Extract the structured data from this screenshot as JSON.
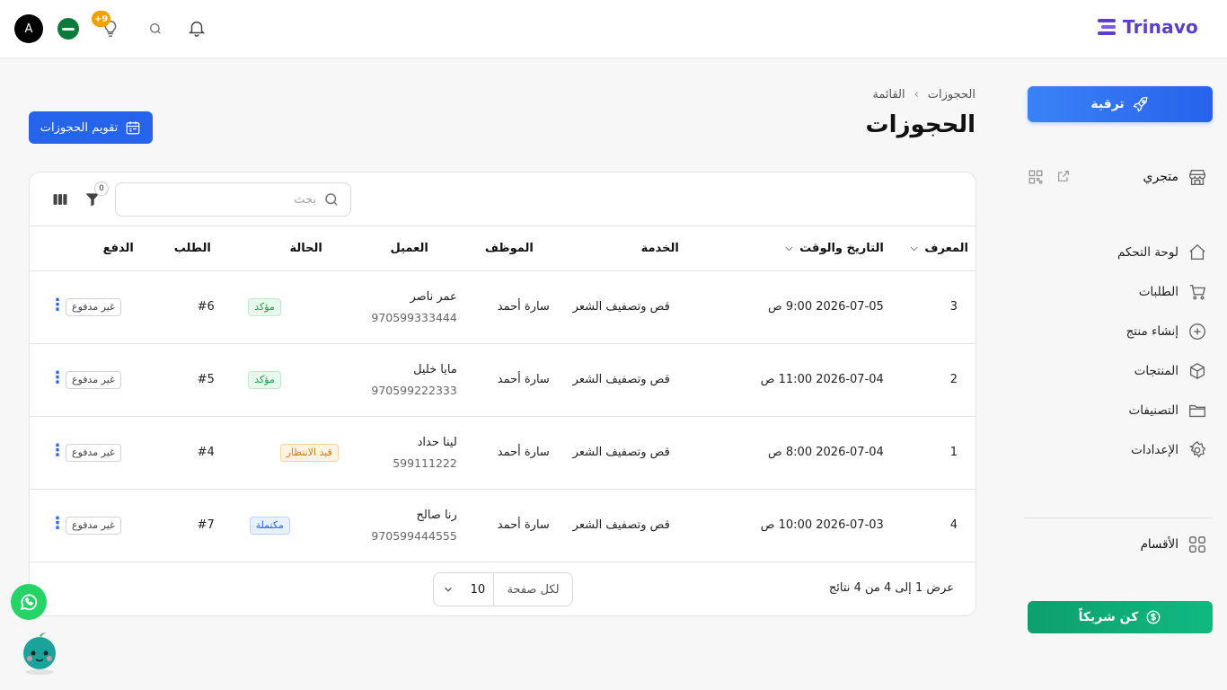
{
  "brand": {
    "name": "Trinavo"
  },
  "topbar": {
    "avatar_letter": "A",
    "tips_badge": "+9"
  },
  "sidebar": {
    "upgrade_label": "ترقية",
    "store_label": "متجري",
    "items": [
      {
        "label": "لوحة التحكم",
        "icon": "home-icon"
      },
      {
        "label": "الطلبات",
        "icon": "cart-icon"
      },
      {
        "label": "إنشاء منتج",
        "icon": "plus-circle-icon"
      },
      {
        "label": "المنتجات",
        "icon": "box-icon"
      },
      {
        "label": "التصنيفات",
        "icon": "folder-icon"
      },
      {
        "label": "الإعدادات",
        "icon": "gear-icon"
      }
    ],
    "sections_label": "الأقسام",
    "partner_label": "كن شريكاً"
  },
  "breadcrumb": {
    "root": "الحجوزات",
    "current": "القائمة"
  },
  "page": {
    "title": "الحجوزات",
    "calendar_button": "تقويم الحجوزات"
  },
  "toolbar": {
    "search_placeholder": "بحث",
    "filter_count": "0"
  },
  "table": {
    "headers": {
      "id": "المعرف",
      "datetime": "التاريخ والوقت",
      "service": "الخدمة",
      "employee": "الموظف",
      "client": "العميل",
      "status": "الحالة",
      "order": "الطلب",
      "payment": "الدفع"
    },
    "rows": [
      {
        "id": "3",
        "datetime": "2026-07-05 9:00 ص",
        "service": "قص وتصفيف الشعر",
        "employee": "سارة أحمد",
        "client_name": "عمر ناصر",
        "client_phone": "970599333444",
        "status": "مؤكد",
        "status_type": "confirmed",
        "order": "#6",
        "payment": "غير مدفوع"
      },
      {
        "id": "2",
        "datetime": "2026-07-04 11:00 ص",
        "service": "قص وتصفيف الشعر",
        "employee": "سارة أحمد",
        "client_name": "مايا خليل",
        "client_phone": "970599222333",
        "status": "مؤكد",
        "status_type": "confirmed",
        "order": "#5",
        "payment": "غير مدفوع"
      },
      {
        "id": "1",
        "datetime": "2026-07-04 8:00 ص",
        "service": "قص وتصفيف الشعر",
        "employee": "سارة أحمد",
        "client_name": "لينا حداد",
        "client_phone": "599111222",
        "status": "قيد الانتظار",
        "status_type": "pending",
        "order": "#4",
        "payment": "غير مدفوع"
      },
      {
        "id": "4",
        "datetime": "2026-07-03 10:00 ص",
        "service": "قص وتصفيف الشعر",
        "employee": "سارة أحمد",
        "client_name": "رنا صالح",
        "client_phone": "970599444555",
        "status": "مكتملة",
        "status_type": "complete",
        "order": "#7",
        "payment": "غير مدفوع"
      }
    ]
  },
  "footer": {
    "results_text": "عرض 1 إلى 4 من 4 نتائج",
    "per_page_label": "لكل صفحة",
    "per_page_value": "10"
  },
  "colors": {
    "primary": "#2563eb",
    "brand": "#5b3fc4",
    "partner": "#10b981",
    "whatsapp": "#25d366"
  }
}
